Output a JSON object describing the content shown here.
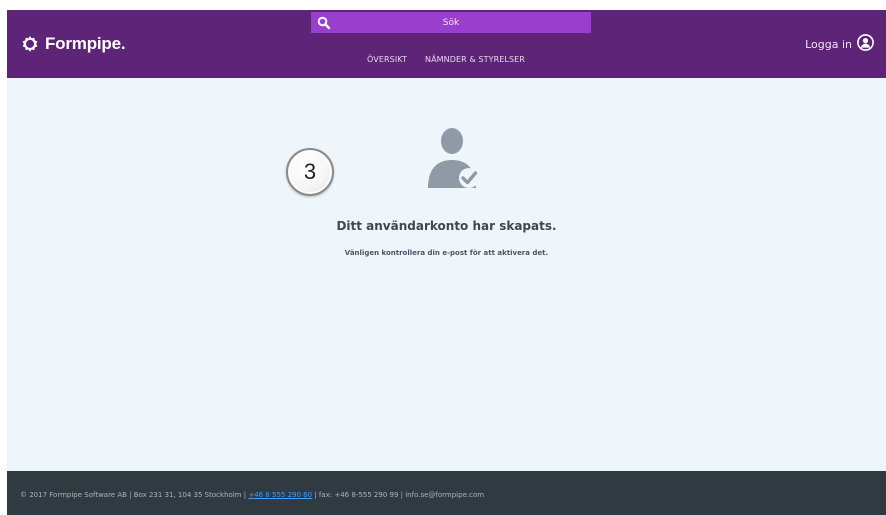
{
  "header": {
    "brand": "Formpipe.",
    "search": {
      "placeholder": "Sök",
      "icon": "search-icon"
    },
    "nav": [
      {
        "label": "ÖVERSIKT"
      },
      {
        "label": "NÄMNDER & STYRELSER"
      }
    ],
    "login": {
      "label": "Logga in",
      "icon": "user-circle-icon"
    }
  },
  "main": {
    "step_number": "3",
    "icon": "user-check-icon",
    "title": "Ditt användarkonto har skapats.",
    "subtitle": "Vänligen kontrollera din e-post för att aktivera det."
  },
  "footer": {
    "prefix": "© 2017 Formpipe Software AB | Box 231 31, 104 35 Stockholm | ",
    "phone": "+46 8 555 290 60",
    "suffix": " | fax: +46 8-555 290 99 | info.se@formpipe.com"
  },
  "colors": {
    "header_bg": "#5d2478",
    "search_bg": "#9a3fcd",
    "content_bg": "#eef6fb",
    "footer_bg": "#2f3b40",
    "link": "#3aa0ff"
  }
}
